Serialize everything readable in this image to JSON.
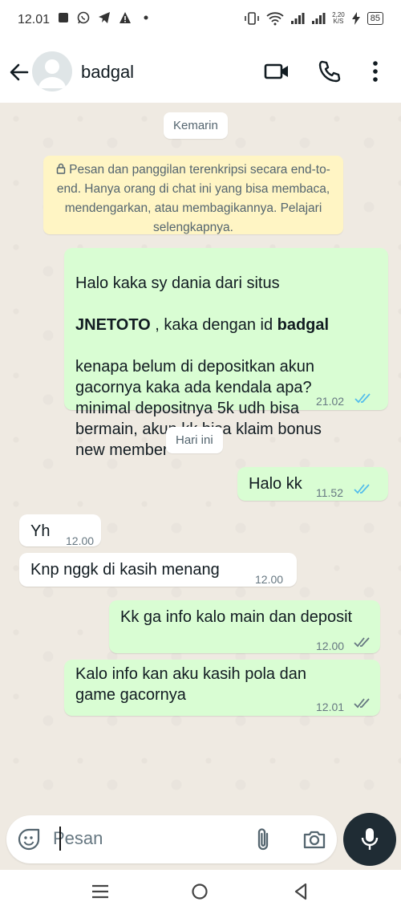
{
  "status_bar": {
    "time": "12.01",
    "net_speed_value": "2,20",
    "net_speed_unit": "K/S",
    "battery": "85",
    "icons": [
      "gallery-icon",
      "whatsapp-icon",
      "telegram-icon",
      "warning-icon",
      "dot-icon",
      "vibrate-icon",
      "wifi-icon",
      "signal-icon",
      "signal-icon",
      "charging-icon",
      "battery-icon"
    ]
  },
  "header": {
    "contact_name": "badgal",
    "icons": [
      "back-arrow-icon",
      "avatar",
      "video-call-icon",
      "voice-call-icon",
      "more-options-icon"
    ]
  },
  "chat": {
    "date_yesterday": "Kemarin",
    "encryption_notice": "Pesan dan panggilan terenkripsi secara end-to-end. Hanya orang di chat ini yang bisa membaca, mendengarkan, atau membagikannya. Pelajari selengkapnya.",
    "date_today": "Hari ini",
    "messages": [
      {
        "direction": "out",
        "text_1": "Halo kaka sy dania dari situs",
        "text_bold_1": "JNETOTO",
        "text_2": " , kaka dengan id ",
        "text_bold_2": "badgal",
        "text_3": "kenapa belum di depositkan akun gacornya kaka ada kendala apa? minimal depositnya 5k udh bisa bermain, akun kk bisa klaim bonus new member",
        "time": "21.02",
        "status": "read"
      },
      {
        "direction": "out",
        "text": "Halo kk",
        "time": "11.52",
        "status": "read"
      },
      {
        "direction": "in",
        "text": "Yh",
        "time": "12.00"
      },
      {
        "direction": "in",
        "text": "Knp nggk di kasih menang",
        "time": "12.00"
      },
      {
        "direction": "out",
        "text": "Kk ga info kalo main dan deposit",
        "time": "12.00",
        "status": "delivered"
      },
      {
        "direction": "out",
        "text": "Kalo info kan aku kasih pola dan game gacornya",
        "time": "12.01",
        "status": "delivered"
      }
    ]
  },
  "composer": {
    "placeholder": "Pesan",
    "icons": [
      "emoji-icon",
      "attach-icon",
      "camera-icon",
      "mic-icon"
    ]
  },
  "colors": {
    "outgoing_bubble": "#d9fdd3",
    "incoming_bubble": "#ffffff",
    "read_ticks": "#53bdeb",
    "delivered_ticks": "#667781",
    "chat_background": "#efeae2",
    "encryption_notice_bg": "#fff5c4",
    "mic_button": "#1f2c34"
  }
}
